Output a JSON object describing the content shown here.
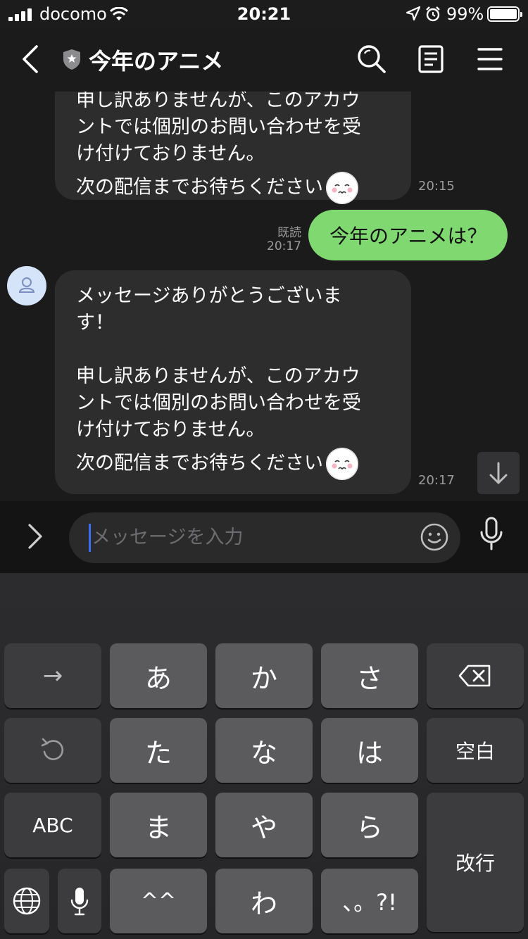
{
  "status_bar": {
    "carrier": "docomo",
    "time": "20:21",
    "battery_percent": "99%"
  },
  "header": {
    "title": "今年のアニメ"
  },
  "messages": [
    {
      "lines": [
        "申し訳ありませんが、このアカウ",
        "ントでは個別のお問い合わせを受",
        "け付けておりません。",
        "次の配信までお待ちください"
      ],
      "time": "20:15"
    },
    {
      "text": "今年のアニメは？",
      "read": "既読",
      "time": "20:17"
    },
    {
      "lines": [
        "メッセージありがとうございま",
        "す！",
        "",
        "申し訳ありませんが、このアカウ",
        "ントでは個別のお問い合わせを受",
        "け付けておりません。",
        "次の配信までお待ちください"
      ],
      "time": "20:17"
    }
  ],
  "input": {
    "placeholder": "メッセージを入力"
  },
  "keyboard": {
    "row1": [
      "→",
      "あ",
      "か",
      "さ"
    ],
    "row2": [
      "た",
      "な",
      "は",
      "空白"
    ],
    "row3": [
      "ABC",
      "ま",
      "や",
      "ら",
      "改行"
    ],
    "row4": [
      "^^",
      "わ",
      "、。?!"
    ]
  },
  "colors": {
    "background": "#1b1b1c",
    "received_bubble": "#2d2d2e",
    "sent_bubble": "#7fd870",
    "caret": "#3b6cf5"
  }
}
